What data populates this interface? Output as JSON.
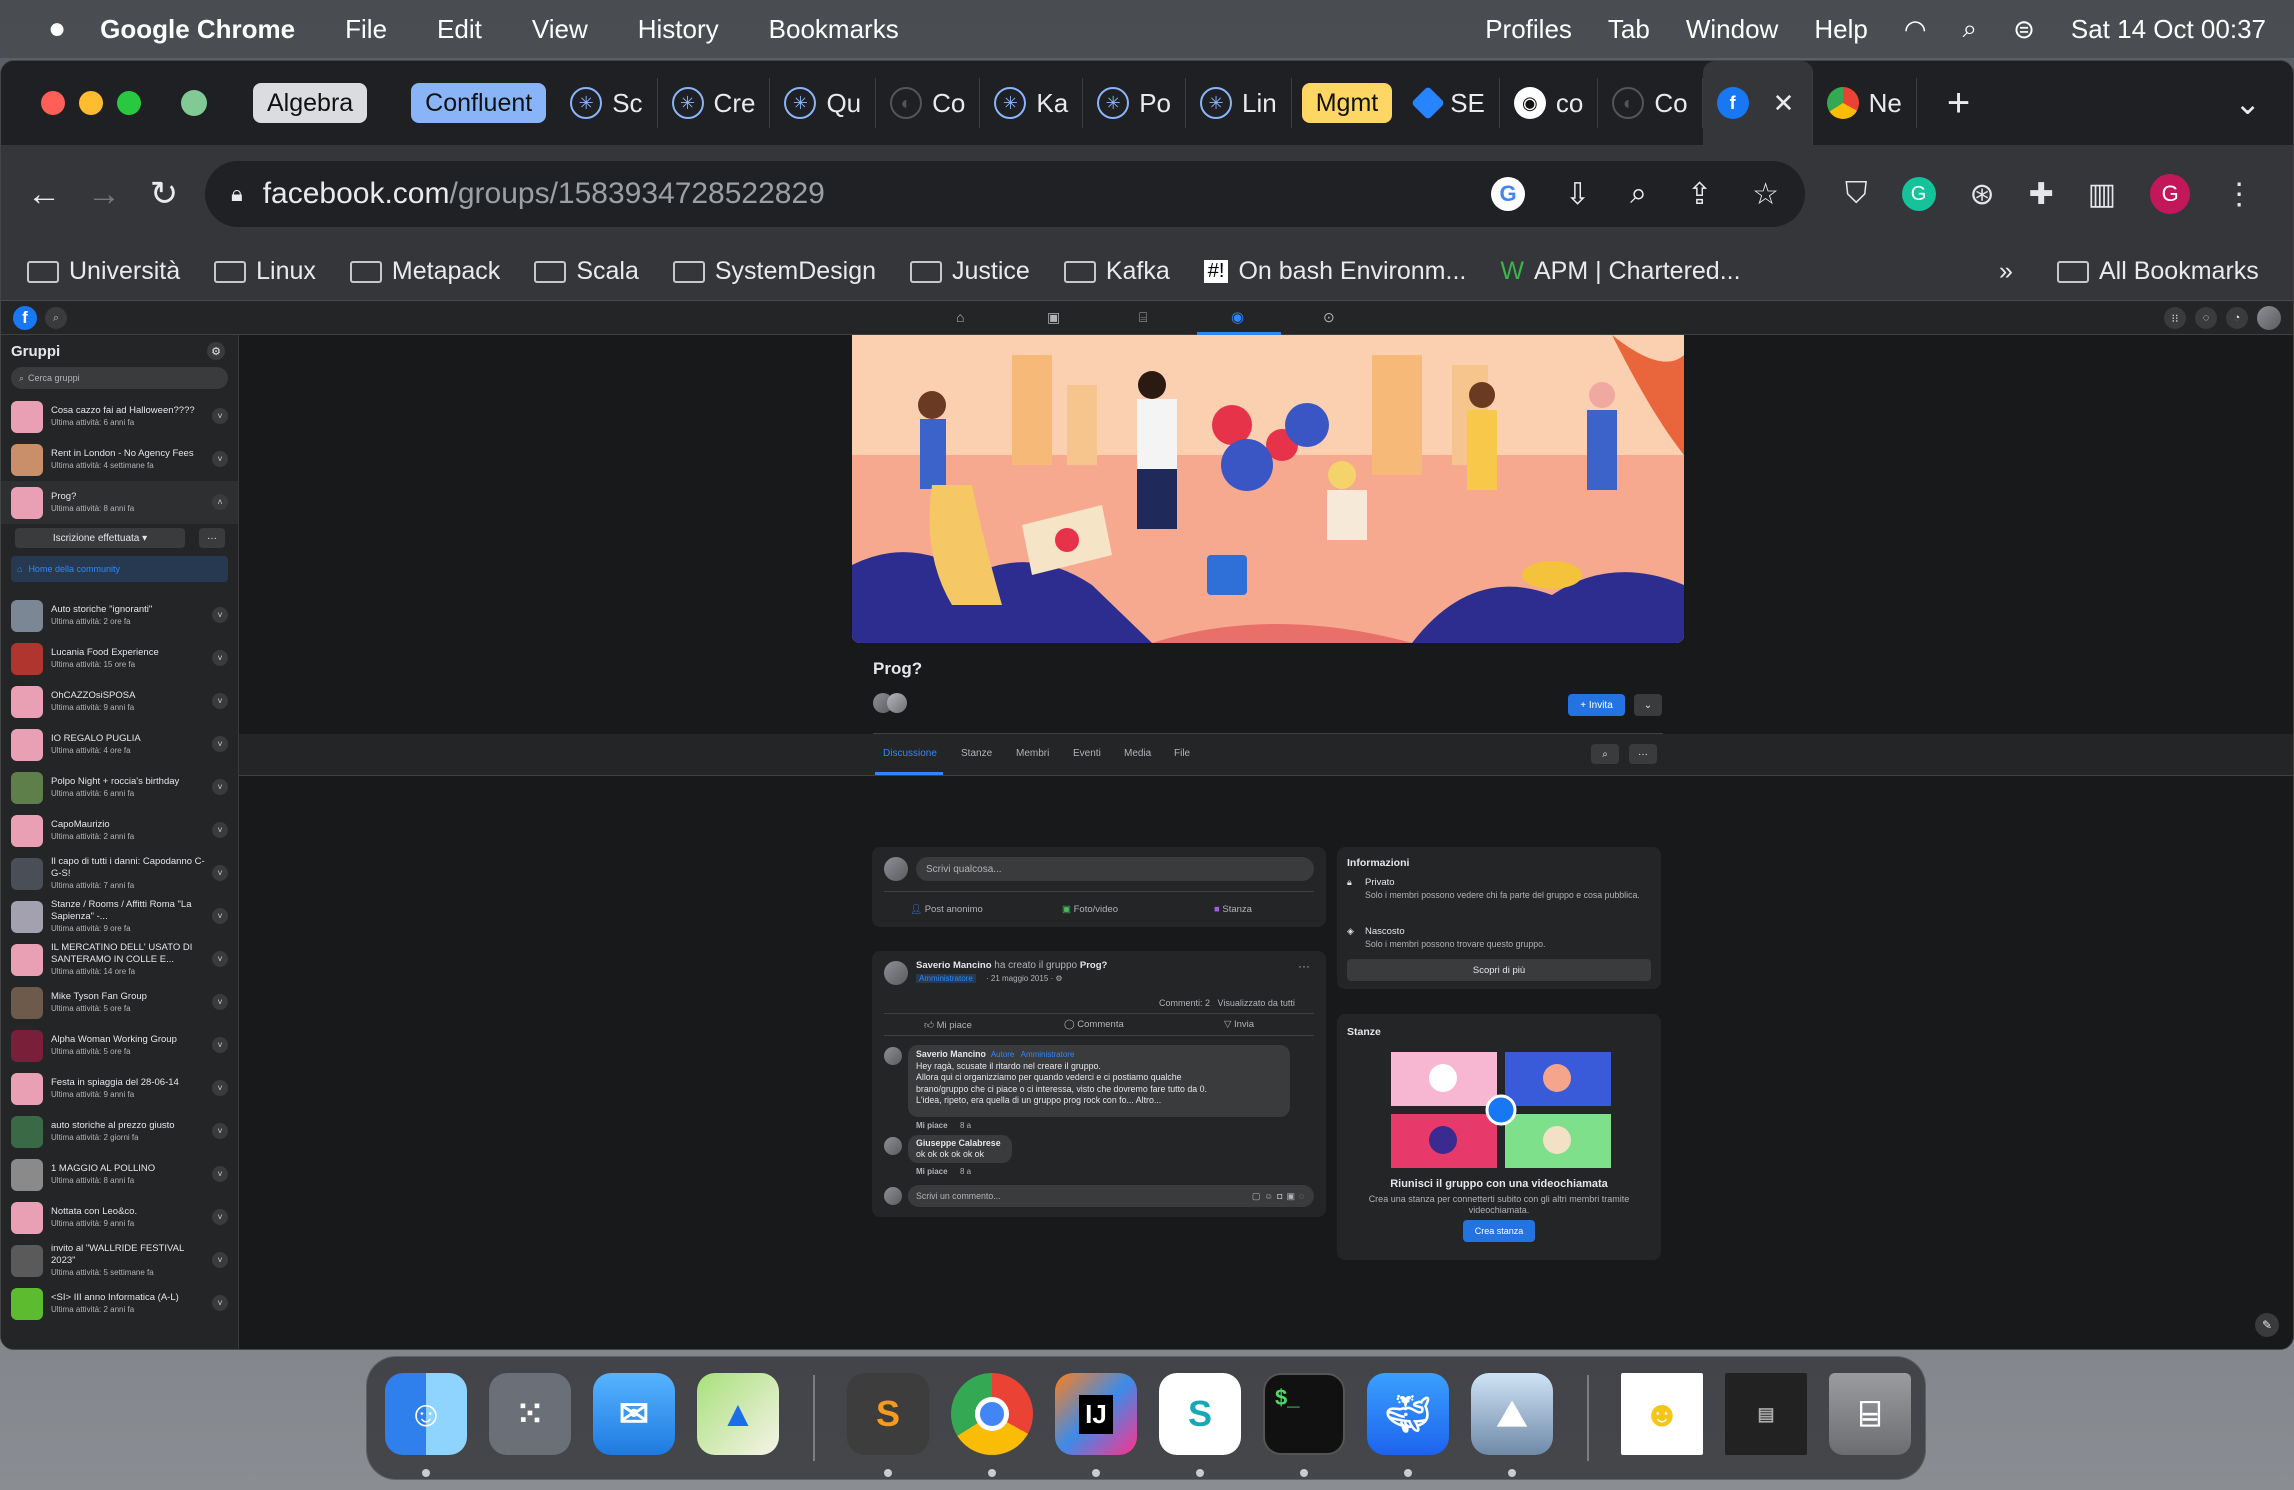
{
  "menubar": {
    "app_name": "Google Chrome",
    "items": [
      "File",
      "Edit",
      "View",
      "History",
      "Bookmarks",
      "Profiles",
      "Tab",
      "Window",
      "Help"
    ],
    "datetime": "Sat 14 Oct  00:37"
  },
  "tabs": {
    "groups": [
      {
        "label": "Algebra",
        "color": "#dadce0"
      },
      {
        "label": "Confluent",
        "color": "#8ab4f8"
      },
      {
        "label": "Mgmt",
        "color": "#fdd663"
      }
    ],
    "titles": [
      "Sc",
      "Cre",
      "Qu",
      "Co",
      "Ka",
      "Po",
      "Lin",
      "SE",
      "co",
      "Co",
      "",
      "Ne"
    ],
    "close_glyph": "✕",
    "new_tab_glyph": "+",
    "more_glyph": "⌄"
  },
  "toolbar": {
    "url_host": "facebook.com",
    "url_path": "/groups/1583934728522829",
    "profile_initial": "G"
  },
  "bookmarks": {
    "items": [
      "Università",
      "Linux",
      "Metapack",
      "Scala",
      "SystemDesign",
      "Justice",
      "Kafka",
      "On bash Environm...",
      "APM | Chartered..."
    ],
    "overflow": "»",
    "all": "All Bookmarks"
  },
  "fb": {
    "sidebar": {
      "title": "Gruppi",
      "search_placeholder": "Cerca gruppi",
      "joined_label": "Iscrizione effettuata",
      "more_label": "···",
      "community_home": "Home della community",
      "groups": [
        {
          "name": "Cosa cazzo fai ad Halloween????",
          "activity": "Ultima attività: 6 anni fa"
        },
        {
          "name": "Rent in London - No Agency Fees",
          "activity": "Ultima attività: 4 settimane fa"
        },
        {
          "name": "Prog?",
          "activity": "Ultima attività: 8 anni fa"
        },
        {
          "name": "Auto storiche \"ignoranti\"",
          "activity": "Ultima attività: 2 ore fa"
        },
        {
          "name": "Lucania Food Experience",
          "activity": "Ultima attività: 15 ore fa"
        },
        {
          "name": "OhCAZZOsiSPOSA",
          "activity": "Ultima attività: 9 anni fa"
        },
        {
          "name": "IO REGALO PUGLIA",
          "activity": "Ultima attività: 4 ore fa"
        },
        {
          "name": "Polpo Night + roccia's birthday",
          "activity": "Ultima attività: 6 anni fa"
        },
        {
          "name": "CapoMaurizio",
          "activity": "Ultima attività: 2 anni fa"
        },
        {
          "name": "Il capo di tutti i danni: Capodanno C-G-S!",
          "activity": "Ultima attività: 7 anni fa"
        },
        {
          "name": "Stanze / Rooms / Affitti Roma \"La Sapienza\" -...",
          "activity": "Ultima attività: 9 ore fa"
        },
        {
          "name": "IL MERCATINO DELL' USATO DI SANTERAMO IN COLLE E...",
          "activity": "Ultima attività: 14 ore fa"
        },
        {
          "name": "Mike Tyson Fan Group",
          "activity": "Ultima attività: 5 ore fa"
        },
        {
          "name": "Alpha Woman Working Group",
          "activity": "Ultima attività: 5 ore fa"
        },
        {
          "name": "Festa in spiaggia del 28-06-14",
          "activity": "Ultima attività: 9 anni fa"
        },
        {
          "name": "auto storiche al prezzo giusto",
          "activity": "Ultima attività: 2 giorni fa"
        },
        {
          "name": "1 MAGGIO AL POLLINO",
          "activity": "Ultima attività: 8 anni fa"
        },
        {
          "name": "Nottata con Leo&co.",
          "activity": "Ultima attività: 9 anni fa"
        },
        {
          "name": "invito al \"WALLRIDE FESTIVAL 2023\"",
          "activity": "Ultima attività: 5 settimane fa"
        },
        {
          "name": "<SI> III anno Informatica (A-L)",
          "activity": "Ultima attività: 2 anni fa"
        }
      ]
    },
    "group": {
      "name": "Prog?",
      "invite_label": "+ Invita",
      "tabs": [
        "Discussione",
        "Stanze",
        "Membri",
        "Eventi",
        "Media",
        "File"
      ]
    },
    "composer": {
      "placeholder": "Scrivi qualcosa...",
      "actions": [
        "Post anonimo",
        "Foto/video",
        "Stanza"
      ]
    },
    "post": {
      "author": "Saverio Mancino",
      "action": " ha creato il gruppo ",
      "group": "Prog?",
      "role": "Amministratore",
      "date": "· 21 maggio 2015 · ⚙",
      "stats": "Commenti: 2   Visualizzato da tutti",
      "buttons": [
        "Mi piace",
        "Commenta",
        "Invia"
      ],
      "comments": [
        {
          "author": "Saverio Mancino",
          "badges": "Autore   Amministratore",
          "text1": "Hey ragà, scusate il ritardo nel creare il gruppo.",
          "text2": "Allora qui ci organizziamo per quando vederci e ci postiamo qualche",
          "text3": "brano/gruppo che ci piace o ci interessa, visto che dovremo fare tutto da 0.",
          "text4": "L'idea, ripeto, era quella di un gruppo prog rock con fo... Altro...",
          "like": "Mi piace",
          "age": "8 a"
        },
        {
          "author": "Giuseppe Calabrese",
          "text1": "ok ok ok ok ok ok",
          "like": "Mi piace",
          "age": "8 a"
        }
      ],
      "comment_placeholder": "Scrivi un commento..."
    },
    "info": {
      "title": "Informazioni",
      "private_title": "Privato",
      "private_desc": "Solo i membri possono vedere chi fa parte del gruppo e cosa pubblica.",
      "hidden_title": "Nascosto",
      "hidden_desc": "Solo i membri possono trovare questo gruppo.",
      "discover": "Scopri di più"
    },
    "rooms": {
      "title": "Stanze",
      "headline": "Riunisci il gruppo con una videochiamata",
      "desc": "Crea una stanza per connetterti subito con gli altri membri tramite videochiamata.",
      "button": "Crea stanza"
    }
  },
  "dock": {
    "apps": [
      "finder-icon",
      "launchpad-icon",
      "mail-icon",
      "maps-icon",
      "sublime-icon",
      "chrome-icon",
      "intellij-icon",
      "surfshark-icon",
      "terminal-icon",
      "docker-icon",
      "preview-icon",
      "simpsons-icon",
      "screenshot-icon",
      "trash-icon"
    ]
  }
}
